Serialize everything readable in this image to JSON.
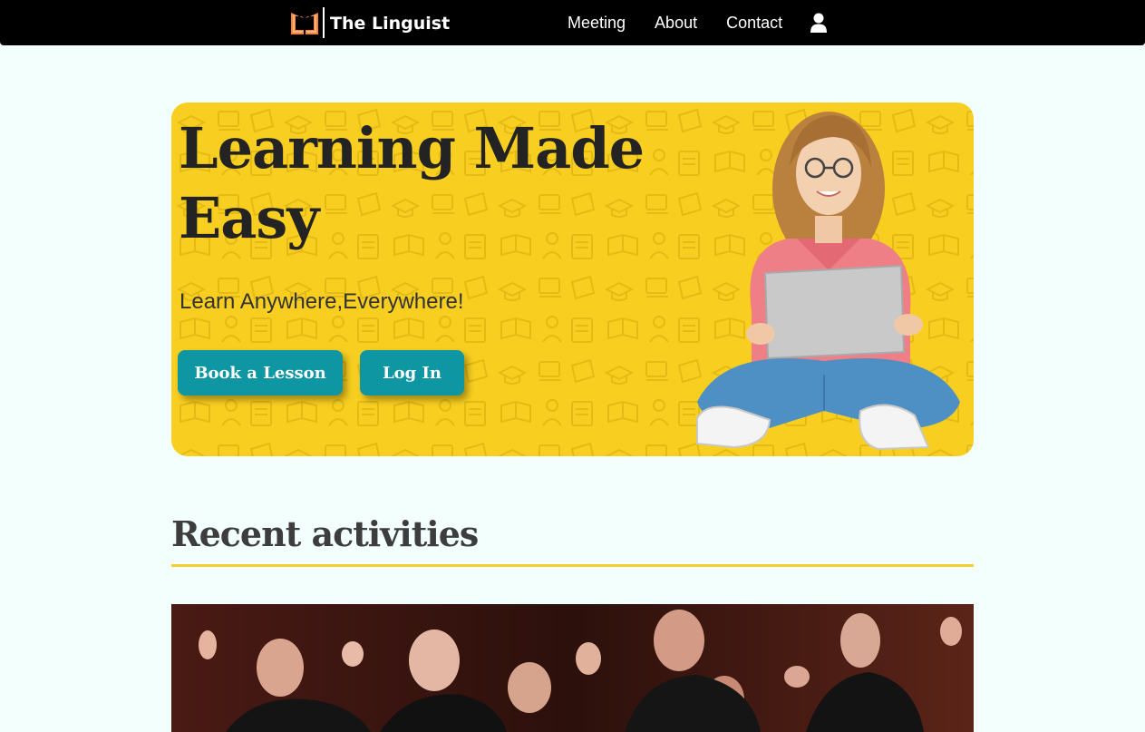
{
  "navbar": {
    "brand": "The Linguist",
    "links": [
      "Meeting",
      "About",
      "Contact"
    ],
    "brand_color": "#f4833d",
    "user_icon": "user-icon"
  },
  "hero": {
    "title": "Learning Made Easy",
    "subtitle": "Learn Anywhere,Everywhere!",
    "book_button": "Book a Lesson",
    "login_button": "Log In",
    "background_color": "#f8cf20",
    "button_color": "#0e96a2"
  },
  "activities": {
    "title": "Recent activities",
    "rule_color": "#f4cf2c"
  }
}
